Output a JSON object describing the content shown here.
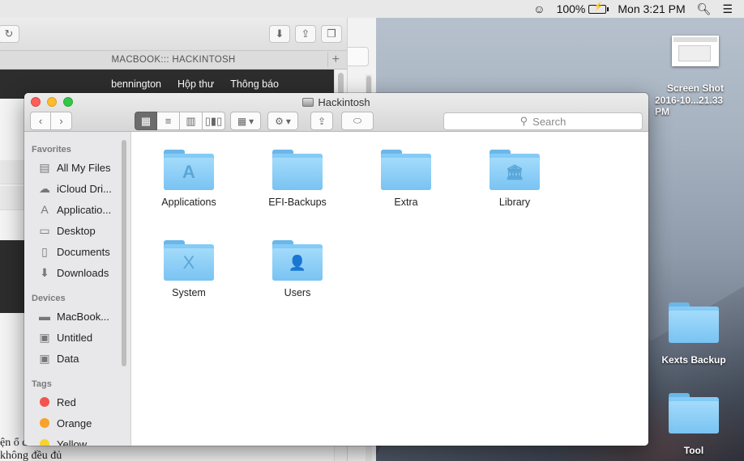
{
  "menubar": {
    "battery_percent": "100%",
    "clock": "Mon 3:21 PM",
    "icons": [
      "user-icon",
      "battery-icon",
      "spotlight-icon",
      "notification-center-icon"
    ]
  },
  "browser": {
    "tab_title": "MACBOOK::: HACKINTOSH",
    "nav": [
      "bennington",
      "Hộp thư",
      "Thông báo"
    ],
    "body_text": "ện ổ đĩa cài macOS thì không đều đủ"
  },
  "desktop": {
    "items": [
      {
        "label": "Screen Shot",
        "sublabel": "2016-10...21.33 PM",
        "icon": "screenshot-file-icon"
      },
      {
        "label": "Kexts Backup",
        "icon": "folder-icon"
      },
      {
        "label": "Tool",
        "icon": "folder-icon"
      }
    ]
  },
  "finder": {
    "title": "Hackintosh",
    "search_placeholder": "Search",
    "sidebar": {
      "favorites_heading": "Favorites",
      "favorites": [
        {
          "label": "All My Files",
          "icon": "all-files-icon"
        },
        {
          "label": "iCloud Dri...",
          "icon": "cloud-icon"
        },
        {
          "label": "Applicatio...",
          "icon": "applications-icon"
        },
        {
          "label": "Desktop",
          "icon": "desktop-icon"
        },
        {
          "label": "Documents",
          "icon": "documents-icon"
        },
        {
          "label": "Downloads",
          "icon": "downloads-icon"
        }
      ],
      "devices_heading": "Devices",
      "devices": [
        {
          "label": "MacBook...",
          "icon": "laptop-icon"
        },
        {
          "label": "Untitled",
          "icon": "disk-icon"
        },
        {
          "label": "Data",
          "icon": "disk-icon"
        }
      ],
      "tags_heading": "Tags",
      "tags": [
        {
          "label": "Red",
          "color": "#f5534e"
        },
        {
          "label": "Orange",
          "color": "#f8a12b"
        },
        {
          "label": "Yellow",
          "color": "#f8d22e"
        }
      ]
    },
    "files": [
      {
        "label": "Applications",
        "icon": "applications-folder-icon",
        "glyph": "A"
      },
      {
        "label": "EFI-Backups",
        "icon": "folder-icon",
        "glyph": ""
      },
      {
        "label": "Extra",
        "icon": "folder-icon",
        "glyph": ""
      },
      {
        "label": "Library",
        "icon": "library-folder-icon",
        "glyph": "🏛"
      },
      {
        "label": "System",
        "icon": "system-folder-icon",
        "glyph": "X"
      },
      {
        "label": "Users",
        "icon": "users-folder-icon",
        "glyph": "👤"
      }
    ]
  }
}
